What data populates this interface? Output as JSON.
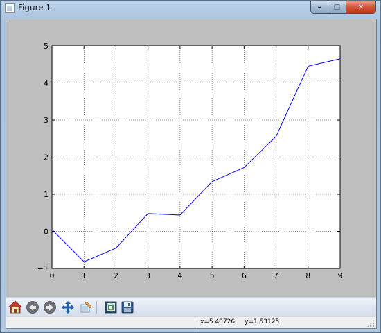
{
  "window": {
    "title": "Figure 1",
    "controls": {
      "minimize": "–",
      "maximize": "□",
      "close": "✕"
    }
  },
  "toolbar": {
    "buttons": [
      {
        "name": "home-button",
        "icon": "home-icon"
      },
      {
        "name": "back-button",
        "icon": "arrow-left-icon"
      },
      {
        "name": "forward-button",
        "icon": "arrow-right-icon"
      },
      {
        "name": "pan-button",
        "icon": "move-arrows-icon"
      },
      {
        "name": "zoom-button",
        "icon": "zoom-rect-icon"
      },
      {
        "name": "subplots-button",
        "icon": "configure-subplots-icon"
      },
      {
        "name": "save-button",
        "icon": "floppy-disk-icon"
      }
    ]
  },
  "statusbar": {
    "x_readout": "x=5.40726",
    "y_readout": "y=1.53125"
  },
  "chart_data": {
    "type": "line",
    "title": "",
    "xlabel": "",
    "ylabel": "",
    "x": [
      0,
      1,
      2,
      3,
      4,
      5,
      6,
      7,
      8,
      9
    ],
    "series": [
      {
        "color": "#0000ff",
        "values": [
          0.05,
          -0.82,
          -0.45,
          0.48,
          0.44,
          1.34,
          1.72,
          2.56,
          4.45,
          4.65
        ]
      }
    ],
    "xlim": [
      0,
      9
    ],
    "ylim": [
      -1,
      5
    ],
    "xticks": [
      0,
      1,
      2,
      3,
      4,
      5,
      6,
      7,
      8,
      9
    ],
    "yticks": [
      -1,
      0,
      1,
      2,
      3,
      4,
      5
    ],
    "grid": true,
    "grid_style": "dotted",
    "background": "#ffffff",
    "figure_background": "#bfbfbf"
  }
}
